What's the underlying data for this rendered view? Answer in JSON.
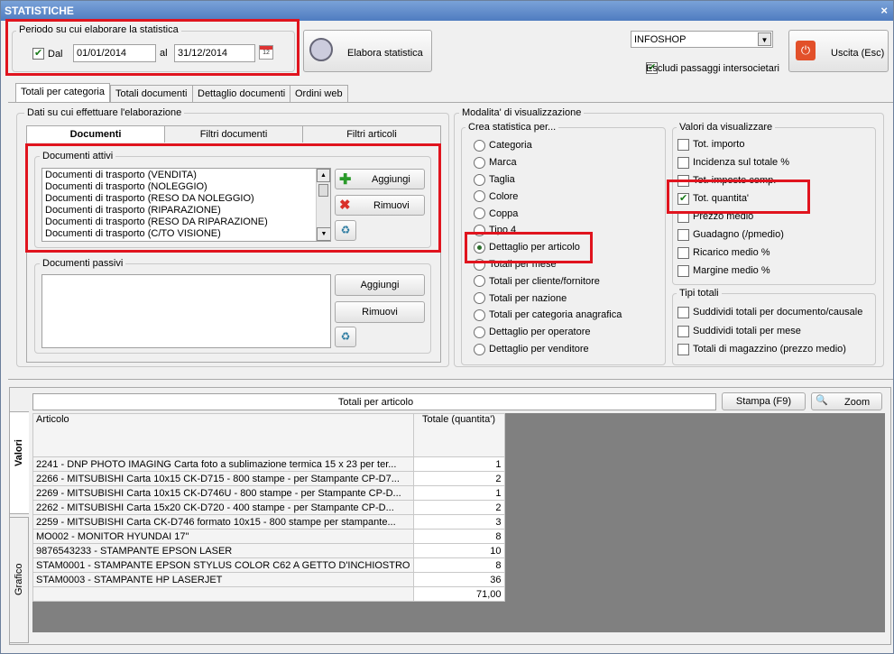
{
  "window": {
    "title": "STATISTICHE",
    "close_glyph": "×"
  },
  "periodo": {
    "legend": "Periodo su cui elaborare la statistica",
    "dal_label": "Dal",
    "dal_value": "01/01/2014",
    "al_label": "al",
    "al_value": "31/12/2014"
  },
  "toolbar": {
    "elabora_label": "Elabora statistica",
    "uscita_label": "Uscita (Esc)",
    "shop_value": "INFOSHOP",
    "escludi_label": "Escludi passaggi intersocietari"
  },
  "tabs": [
    "Totali per categoria",
    "Totali documenti",
    "Dettaglio documenti",
    "Ordini web"
  ],
  "dati": {
    "legend": "Dati su cui effettuare l'elaborazione",
    "subtabs": [
      "Documenti",
      "Filtri documenti",
      "Filtri articoli"
    ]
  },
  "attivi": {
    "legend": "Documenti attivi",
    "items": [
      "Documenti di trasporto (VENDITA)",
      "Documenti di trasporto (NOLEGGIO)",
      "Documenti di trasporto (RESO DA NOLEGGIO)",
      "Documenti di trasporto (RIPARAZIONE)",
      "Documenti di trasporto (RESO DA RIPARAZIONE)",
      "Documenti di trasporto (C/TO VISIONE)"
    ],
    "aggiungi": "Aggiungi",
    "rimuovi": "Rimuovi"
  },
  "passivi": {
    "legend": "Documenti passivi",
    "aggiungi": "Aggiungi",
    "rimuovi": "Rimuovi"
  },
  "modalita": {
    "legend": "Modalita' di visualizzazione"
  },
  "crea": {
    "legend": "Crea statistica per...",
    "options": [
      "Categoria",
      "Marca",
      "Taglia",
      "Colore",
      "Coppa",
      "Tipo 4",
      "Dettaglio per articolo",
      "Totali per mese",
      "Totali per cliente/fornitore",
      "Totali per nazione",
      "Totali per categoria anagrafica",
      "Dettaglio per operatore",
      "Dettaglio per venditore"
    ],
    "selected": 6
  },
  "valori": {
    "legend": "Valori da visualizzare",
    "options": [
      "Tot. importo",
      "Incidenza sul totale %",
      "Tot. imposte comp.",
      "Tot. quantita'",
      "Prezzo medio",
      "Guadagno (/pmedio)",
      "Ricarico medio %",
      "Margine medio %"
    ],
    "checked": [
      3
    ]
  },
  "tipi": {
    "legend": "Tipi totali",
    "options": [
      "Suddividi totali per documento/causale",
      "Suddividi totali per mese",
      "Totali di magazzino (prezzo medio)"
    ]
  },
  "results": {
    "title": "Totali per articolo",
    "stampa": "Stampa (F9)",
    "zoom": "Zoom",
    "side_tabs": [
      "Valori",
      "Grafico"
    ],
    "col_articolo": "Articolo",
    "col_totale": "Totale (quantita')",
    "rows": [
      {
        "articolo": "2241 - DNP PHOTO IMAGING Carta foto a sublimazione termica 15 x 23 per ter...",
        "totale": "1"
      },
      {
        "articolo": "2266 - MITSUBISHI Carta 10x15 CK-D715 - 800 stampe - per Stampante CP-D7...",
        "totale": "2"
      },
      {
        "articolo": "2269 - MITSUBISHI Carta 10x15 CK-D746U - 800 stampe - per Stampante CP-D...",
        "totale": "1"
      },
      {
        "articolo": "2262 - MITSUBISHI Carta 15x20 CK-D720 - 400  stampe - per Stampante CP-D...",
        "totale": "2"
      },
      {
        "articolo": "2259 - MITSUBISHI Carta CK-D746 formato 10x15 - 800 stampe per stampante...",
        "totale": "3"
      },
      {
        "articolo": "MO002 - MONITOR HYUNDAI 17\"",
        "totale": "8"
      },
      {
        "articolo": "9876543233 - STAMPANTE EPSON LASER",
        "totale": "10"
      },
      {
        "articolo": "STAM0001 - STAMPANTE EPSON STYLUS COLOR C62 A GETTO D'INCHIOSTRO",
        "totale": "8"
      },
      {
        "articolo": "STAM0003 - STAMPANTE HP LASERJET",
        "totale": "36"
      },
      {
        "articolo": "",
        "totale": "71,00"
      }
    ]
  }
}
